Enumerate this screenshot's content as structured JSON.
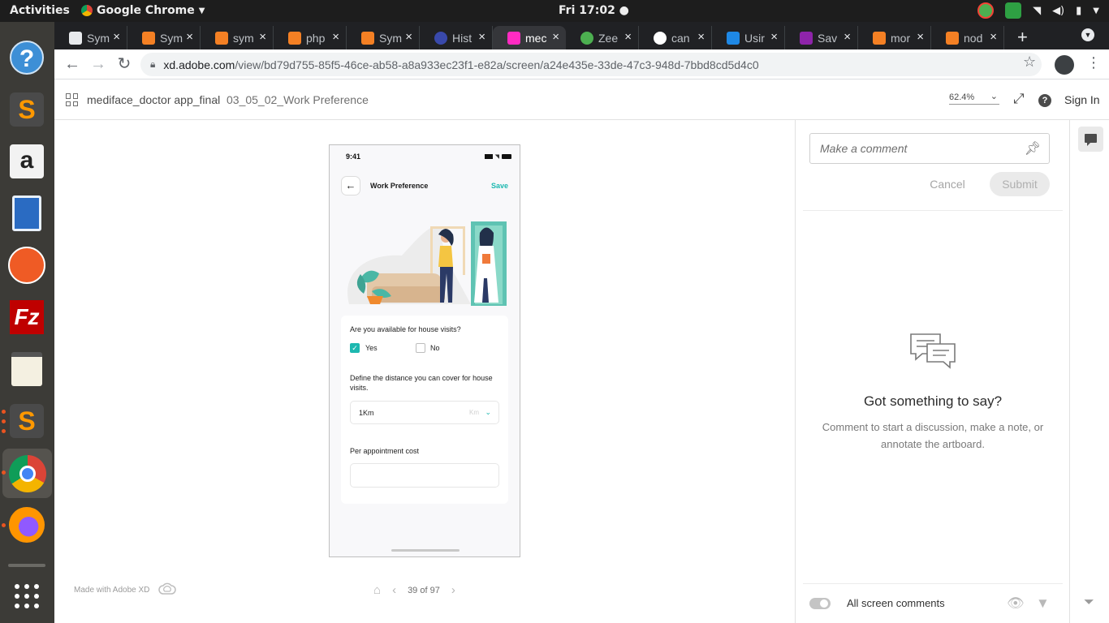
{
  "system": {
    "activities": "Activities",
    "app_name": "Google Chrome",
    "clock": "Fri 17:02 ●"
  },
  "dock": {
    "items": [
      "help",
      "sublime-text",
      "amazon",
      "libreoffice-writer",
      "postman",
      "filezilla",
      "text-editor",
      "sublime-text",
      "chrome",
      "firefox",
      "show-apps"
    ]
  },
  "browser": {
    "tabs": [
      {
        "label": "Sym",
        "favicon": "github-icon"
      },
      {
        "label": "Sym",
        "favicon": "stackoverflow-icon"
      },
      {
        "label": "sym",
        "favicon": "stackoverflow-icon"
      },
      {
        "label": "php",
        "favicon": "stackoverflow-icon"
      },
      {
        "label": "Sym",
        "favicon": "stackoverflow-icon"
      },
      {
        "label": "Hist",
        "favicon": "history-icon"
      },
      {
        "label": "mec",
        "favicon": "adobe-xd-icon",
        "active": true
      },
      {
        "label": "Zee",
        "favicon": "zeebe-icon"
      },
      {
        "label": "can",
        "favicon": "google-icon"
      },
      {
        "label": "Usir",
        "favicon": "blog-icon"
      },
      {
        "label": "Sav",
        "favicon": "savvy-icon"
      },
      {
        "label": "mor",
        "favicon": "stackoverflow-icon"
      },
      {
        "label": "nod",
        "favicon": "stackoverflow-icon"
      }
    ],
    "url_host": "xd.adobe.com",
    "url_path": "/view/bd79d755-85f5-46ce-ab58-a8a933ec23f1-e82a/screen/a24e435e-33de-47c3-948d-7bbd8cd5d4c0"
  },
  "xd": {
    "project": "mediface_doctor app_final",
    "screen": "03_05_02_Work Preference",
    "zoom": "62.4%",
    "sign_in": "Sign In",
    "made_with": "Made with Adobe XD",
    "pager": "39 of 97"
  },
  "artboard": {
    "time": "9:41",
    "title": "Work Preference",
    "save": "Save",
    "q_visits": "Are you available for house visits?",
    "yes": "Yes",
    "no": "No",
    "yes_checked": true,
    "q_distance": "Define the distance you can cover for house visits.",
    "distance_value": "1Km",
    "distance_unit": "Km",
    "q_cost": "Per appointment cost",
    "cost_value": ""
  },
  "comments": {
    "placeholder": "Make a comment",
    "cancel": "Cancel",
    "submit": "Submit",
    "empty_title": "Got something to say?",
    "empty_desc": "Comment to start a discussion, make a note, or annotate the artboard.",
    "all_screen": "All screen comments"
  },
  "colors": {
    "accent_teal": "#1db8b0",
    "ubuntu_orange": "#e95420",
    "chrome_dark": "#202124"
  }
}
